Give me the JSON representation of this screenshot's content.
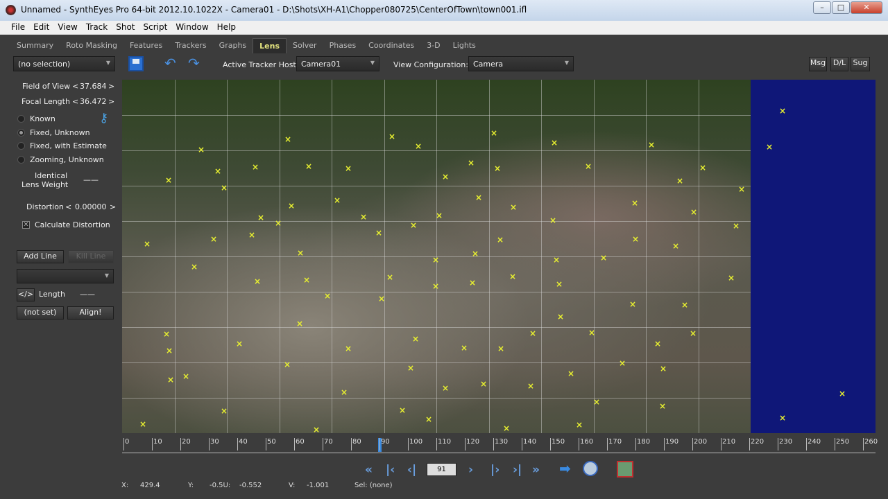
{
  "window": {
    "title": "Unnamed - SynthEyes Pro 64-bit 2012.10.1022X - Camera01 - D:\\Shots\\XH-A1\\Chopper080725\\CenterOfTown\\town001.ifl",
    "min": "–",
    "max": "□",
    "close": "✕"
  },
  "menu": [
    "File",
    "Edit",
    "View",
    "Track",
    "Shot",
    "Script",
    "Window",
    "Help"
  ],
  "tabs": [
    "Summary",
    "Roto Masking",
    "Features",
    "Trackers",
    "Graphs",
    "Lens",
    "Solver",
    "Phases",
    "Coordinates",
    "3-D",
    "Lights"
  ],
  "active_tab": "Lens",
  "toolbar": {
    "selection": "(no selection)",
    "active_tracker_host_label": "Active Tracker Host:",
    "active_tracker_host": "Camera01",
    "view_config_label": "View Configuration:",
    "view_config": "Camera",
    "msg": "Msg",
    "dl": "D/L",
    "sug": "Sug"
  },
  "lens": {
    "fov_label": "Field of View",
    "fov": "37.684",
    "focal_label": "Focal Length",
    "focal": "36.472",
    "lt": "<",
    "gt": ">",
    "modes": [
      "Known",
      "Fixed, Unknown",
      "Fixed, with Estimate",
      "Zooming, Unknown"
    ],
    "selected_mode": 1,
    "identical_1": "Identical",
    "identical_2": "Lens Weight",
    "dash": "——",
    "distortion_label": "Distortion",
    "distortion": "0.00000",
    "calc_distortion": "Calculate Distortion",
    "calc_checked": true,
    "add_line": "Add Line",
    "kill_line": "Kill Line",
    "code": "</>",
    "length": "Length",
    "not_set": "(not set)",
    "align": "Align!"
  },
  "timeline": {
    "ticks": [
      0,
      10,
      20,
      30,
      40,
      50,
      60,
      70,
      80,
      90,
      100,
      110,
      120,
      130,
      140,
      150,
      160,
      170,
      180,
      190,
      200,
      210,
      220,
      230,
      240,
      250,
      260
    ],
    "current_frame": "91"
  },
  "status": {
    "x_label": "X:",
    "x": "429.4",
    "y_label": "Y:",
    "y": "-0.5U:",
    "u": "-0.552",
    "v_label": "V:",
    "v": "-1.001",
    "sel": "Sel: (none)"
  }
}
